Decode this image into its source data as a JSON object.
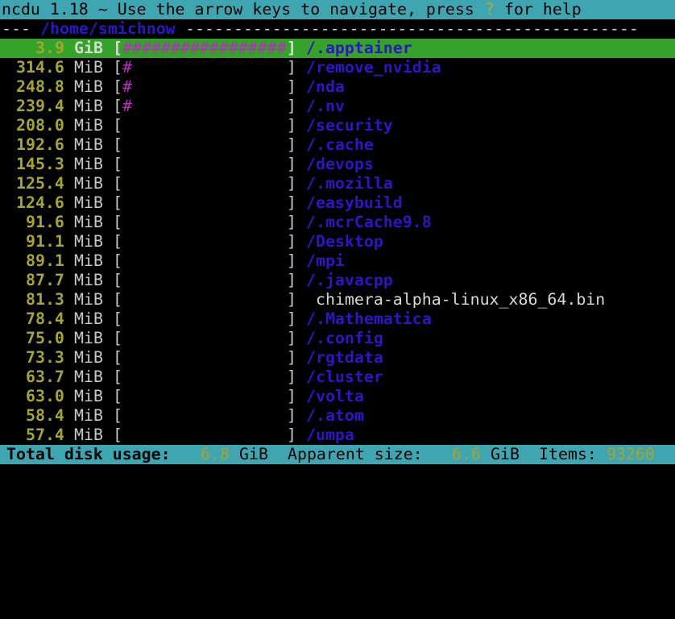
{
  "header": {
    "title_prefix": "ncdu 1.18 ~ Use the arrow keys to navigate, press ",
    "help_key": "?",
    "title_suffix": " for help"
  },
  "path": {
    "prefix": "--- ",
    "dir": "/home/smichnow",
    "suffix": " -----------------------------------------------"
  },
  "rows": [
    {
      "size": "3.9",
      "unit": "GiB",
      "bar": "#################",
      "name": "/.apptainer",
      "dir": true,
      "selected": true
    },
    {
      "size": "314.6",
      "unit": "MiB",
      "bar": "#",
      "name": "/remove_nvidia",
      "dir": true
    },
    {
      "size": "248.8",
      "unit": "MiB",
      "bar": "#",
      "name": "/nda",
      "dir": true
    },
    {
      "size": "239.4",
      "unit": "MiB",
      "bar": "#",
      "name": "/.nv",
      "dir": true
    },
    {
      "size": "208.0",
      "unit": "MiB",
      "bar": "",
      "name": "/security",
      "dir": true
    },
    {
      "size": "192.6",
      "unit": "MiB",
      "bar": "",
      "name": "/.cache",
      "dir": true
    },
    {
      "size": "145.3",
      "unit": "MiB",
      "bar": "",
      "name": "/devops",
      "dir": true
    },
    {
      "size": "125.4",
      "unit": "MiB",
      "bar": "",
      "name": "/.mozilla",
      "dir": true
    },
    {
      "size": "124.6",
      "unit": "MiB",
      "bar": "",
      "name": "/easybuild",
      "dir": true
    },
    {
      "size": "91.6",
      "unit": "MiB",
      "bar": "",
      "name": "/.mcrCache9.8",
      "dir": true
    },
    {
      "size": "91.1",
      "unit": "MiB",
      "bar": "",
      "name": "/Desktop",
      "dir": true
    },
    {
      "size": "89.1",
      "unit": "MiB",
      "bar": "",
      "name": "/mpi",
      "dir": true
    },
    {
      "size": "87.7",
      "unit": "MiB",
      "bar": "",
      "name": "/.javacpp",
      "dir": true
    },
    {
      "size": "81.3",
      "unit": "MiB",
      "bar": "",
      "name": "chimera-alpha-linux_x86_64.bin",
      "dir": false
    },
    {
      "size": "78.4",
      "unit": "MiB",
      "bar": "",
      "name": "/.Mathematica",
      "dir": true
    },
    {
      "size": "75.0",
      "unit": "MiB",
      "bar": "",
      "name": "/.config",
      "dir": true
    },
    {
      "size": "73.3",
      "unit": "MiB",
      "bar": "",
      "name": "/rgtdata",
      "dir": true
    },
    {
      "size": "63.7",
      "unit": "MiB",
      "bar": "",
      "name": "/cluster",
      "dir": true
    },
    {
      "size": "63.0",
      "unit": "MiB",
      "bar": "",
      "name": "/volta",
      "dir": true
    },
    {
      "size": "58.4",
      "unit": "MiB",
      "bar": "",
      "name": "/.atom",
      "dir": true
    },
    {
      "size": "57.4",
      "unit": "MiB",
      "bar": "",
      "name": "/umpa",
      "dir": true
    }
  ],
  "footer": {
    "disk_label": "Total disk usage:",
    "disk_value": "6.8",
    "disk_unit": "GiB",
    "apparent_label": "Apparent size:",
    "apparent_value": "6.6",
    "apparent_unit": "GiB",
    "items_label": "Items:",
    "items_value": "93260"
  },
  "colors": {
    "bar_bg": "#3fa6b1",
    "selected_bg": "#35a22a",
    "dir_name": "#2f14c8",
    "size": "#a8a52c",
    "graph": "#b82cc4"
  }
}
